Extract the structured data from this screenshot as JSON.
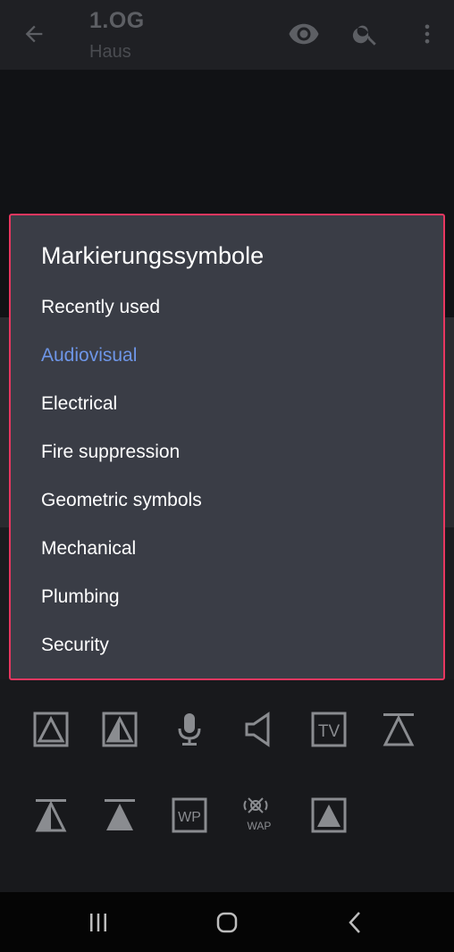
{
  "appbar": {
    "title": "1.OG",
    "subtitle": "Haus",
    "icons": [
      "back-arrow-icon",
      "eye-icon",
      "search-icon",
      "more-vert-icon"
    ]
  },
  "dialog": {
    "title": "Markierungssymbole",
    "items": [
      {
        "label": "Recently used",
        "selected": false
      },
      {
        "label": "Audiovisual",
        "selected": true
      },
      {
        "label": "Electrical",
        "selected": false
      },
      {
        "label": "Fire suppression",
        "selected": false
      },
      {
        "label": "Geometric symbols",
        "selected": false
      },
      {
        "label": "Mechanical",
        "selected": false
      },
      {
        "label": "Plumbing",
        "selected": false
      },
      {
        "label": "Security",
        "selected": false
      }
    ]
  },
  "symbols": {
    "tv_label": "TV",
    "wp_label": "WP",
    "wap_label": "WAP"
  },
  "colors": {
    "accent": "#6e96e8",
    "dialog_border": "#e83760",
    "dialog_bg": "#3a3d46",
    "symbol_gray": "#8a8c90"
  },
  "navbar": {
    "icons": [
      "recents-icon",
      "home-icon",
      "back-icon"
    ]
  }
}
